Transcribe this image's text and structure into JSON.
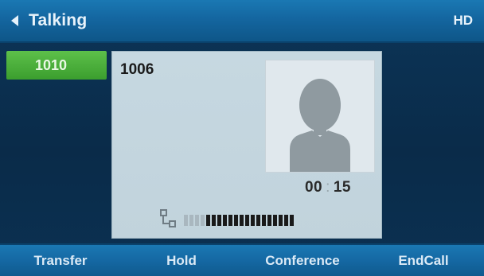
{
  "header": {
    "title": "Talking",
    "hd_badge": "HD"
  },
  "line": {
    "label": "1010"
  },
  "call": {
    "number": "1006",
    "timer_minutes": "00",
    "timer_separator": ":",
    "timer_seconds": "15",
    "signal_level": 0.8
  },
  "softkeys": [
    {
      "label": "Transfer"
    },
    {
      "label": "Hold"
    },
    {
      "label": "Conference"
    },
    {
      "label": "EndCall"
    }
  ],
  "colors": {
    "titlebar": "#1466a0",
    "line_tab": "#3b9e2e",
    "card": "#c6d8e1",
    "bar_filled": "#1a1a1a",
    "bar_empty": "#a9b7bf"
  },
  "icons": {
    "back": "back-arrow-icon",
    "avatar": "contact-avatar-icon",
    "signal": "network-signal-icon"
  }
}
